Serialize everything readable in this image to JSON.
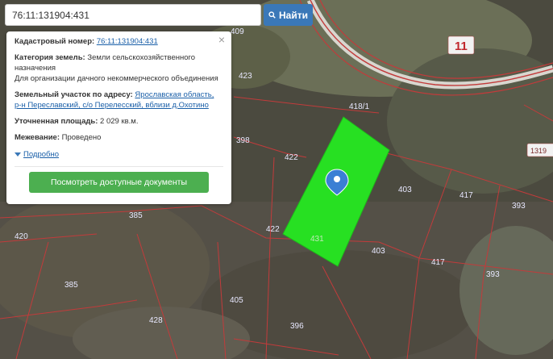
{
  "search": {
    "value": "76:11:131904:431",
    "button_label": "Найти"
  },
  "info_card": {
    "close_symbol": "×",
    "cadastral_number_label": "Кадастровый номер:",
    "cadastral_number_value": "76:11:131904:431",
    "land_category_label": "Категория земель:",
    "land_category_value": "Земли сельскохозяйственного назначения",
    "land_use_value": "Для организации дачного некоммерческого объединения",
    "address_label": "Земельный участок по адресу:",
    "address_line1": "Ярославская область,",
    "address_line2": "р-н Переславский, с/о Перелесский, вблизи д.Охотино",
    "area_label": "Уточненная площадь:",
    "area_value": "2 029 кв.м.",
    "survey_label": "Межевание:",
    "survey_value": "Проведено",
    "more_label": "Подробно",
    "docs_button_label": "Посмотреть доступные документы"
  },
  "map_labels": {
    "l409": "409",
    "l423": "423",
    "l418_1": "418/1",
    "l398": "398",
    "l422a": "422",
    "l403a": "403",
    "l417a": "417",
    "l393a": "393",
    "l385a": "385",
    "l420": "420",
    "l422b": "422",
    "l431": "431",
    "l403b": "403",
    "l417b": "417",
    "l393b": "393",
    "l385b": "385",
    "l405": "405",
    "l428": "428",
    "l396": "396",
    "zone": "11",
    "edge": "1319"
  },
  "colors": {
    "parcel_fill": "#27e022",
    "marker": "#3b7fd4",
    "boundary": "#c23b3b",
    "button_primary": "#3a78b8",
    "button_green": "#4caf50"
  }
}
